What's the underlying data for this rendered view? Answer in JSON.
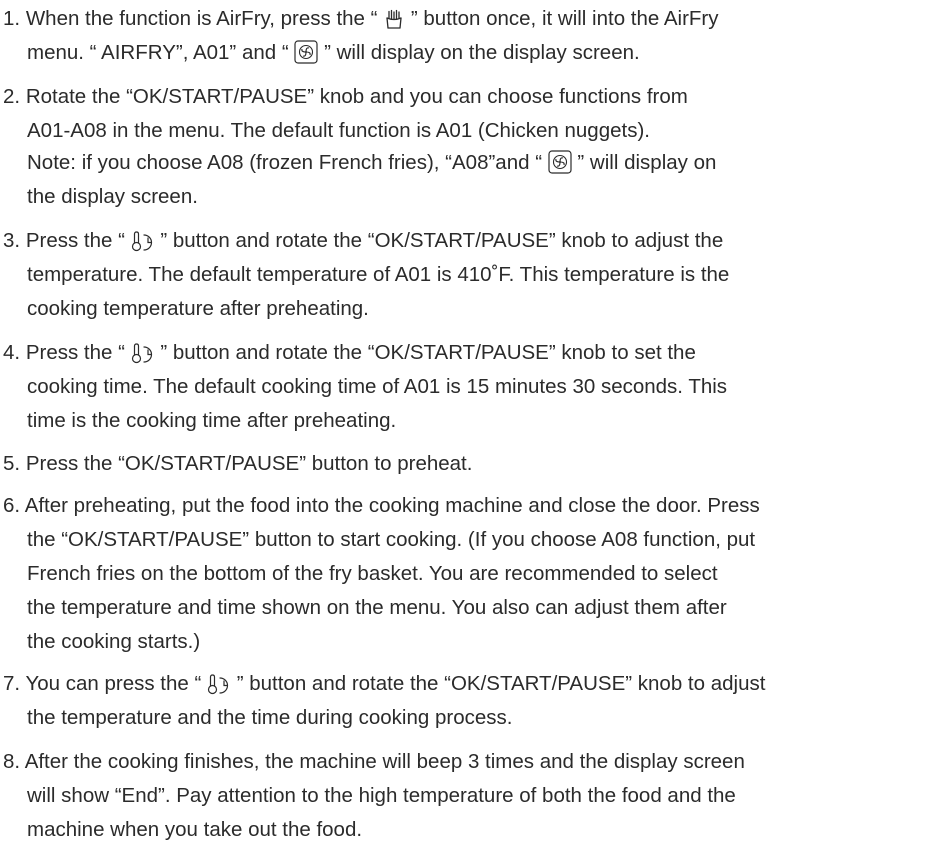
{
  "steps": [
    {
      "number": "1.",
      "lines": [
        {
          "a": "When the function is AirFry, press the “ ",
          "b": " ” button once, it will into the AirFry"
        },
        {
          "a": "menu. “ AIRFRY”, A01” and “ ",
          "b": " ” will display on the display screen."
        }
      ],
      "icons": [
        "fries-icon",
        "fan-icon"
      ]
    },
    {
      "number": "2.",
      "lines": [
        {
          "a": "Rotate the “OK/START/PAUSE” knob and you can choose functions from"
        },
        {
          "a": "A01-A08 in the menu. The default function is A01 (Chicken nuggets)."
        },
        {
          "a": "Note: if you choose A08 (frozen French fries), “A08”and “ ",
          "b": " ” will display on"
        },
        {
          "a": "the display screen."
        }
      ],
      "icons": [
        "fan-icon"
      ]
    },
    {
      "number": "3.",
      "lines": [
        {
          "a": "Press the “ ",
          "b": " ” button and rotate the “OK/START/PAUSE” knob to adjust the"
        },
        {
          "a": "temperature. The default temperature of A01 is 410˚F. This temperature is the"
        },
        {
          "a": "cooking temperature after preheating."
        }
      ],
      "icons": [
        "temp-time-icon"
      ]
    },
    {
      "number": "4.",
      "lines": [
        {
          "a": "Press the “ ",
          "b": " ” button and rotate the “OK/START/PAUSE” knob to set the"
        },
        {
          "a": "cooking time. The default cooking time of A01 is 15 minutes 30 seconds. This"
        },
        {
          "a": "time is the cooking time after preheating."
        }
      ],
      "icons": [
        "temp-time-icon"
      ]
    },
    {
      "number": "5.",
      "lines": [
        {
          "a": "Press the “OK/START/PAUSE” button to preheat."
        }
      ]
    },
    {
      "number": "6.",
      "lines": [
        {
          "a": "After preheating, put the food into the cooking machine and close the door. Press"
        },
        {
          "a": "the “OK/START/PAUSE” button to start cooking. (If you choose A08 function, put"
        },
        {
          "a": "French fries on the bottom of the fry basket. You are recommended to select"
        },
        {
          "a": "the temperature and time shown on the menu. You also can adjust them after"
        },
        {
          "a": "the cooking starts.)"
        }
      ]
    },
    {
      "number": "7.",
      "lines": [
        {
          "a": "You can press the “ ",
          "b": " ” button and rotate the “OK/START/PAUSE” knob to adjust"
        },
        {
          "a": "the temperature and the time during cooking process."
        }
      ],
      "icons": [
        "temp-time-icon"
      ]
    },
    {
      "number": "8.",
      "lines": [
        {
          "a": "After the cooking finishes, the machine will beep 3 times and the display screen"
        },
        {
          "a": "will show “End”. Pay attention to the high temperature of both the food and the"
        },
        {
          "a": "machine when you take out the food."
        }
      ]
    }
  ]
}
